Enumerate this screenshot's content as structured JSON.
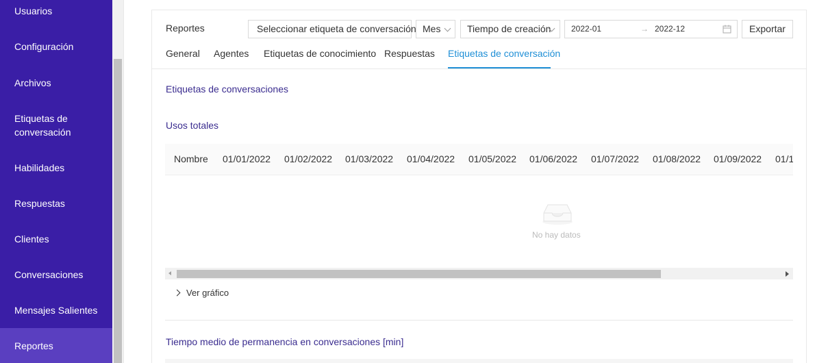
{
  "sidebar": {
    "items": [
      {
        "label": "Usuarios"
      },
      {
        "label": "Configuración"
      },
      {
        "label": "Archivos"
      },
      {
        "label": "Etiquetas de\nconversación"
      },
      {
        "label": "Habilidades"
      },
      {
        "label": "Respuestas"
      },
      {
        "label": "Clientes"
      },
      {
        "label": "Conversaciones"
      },
      {
        "label": "Mensajes Salientes"
      },
      {
        "label": "Reportes"
      }
    ],
    "active": "Reportes"
  },
  "toolbar": {
    "title": "Reportes",
    "tag_select": "Seleccionar etiqueta de conversación",
    "period_select": "Mes",
    "time_type_select": "Tiempo de creación",
    "date_start": "2022-01",
    "date_end": "2022-12",
    "date_arrow": "→",
    "export_label": "Exportar"
  },
  "tabs": [
    {
      "label": "General"
    },
    {
      "label": "Agentes"
    },
    {
      "label": "Etiquetas de conocimiento"
    },
    {
      "label": "Respuestas"
    },
    {
      "label": "Etiquetas de conversación"
    }
  ],
  "active_tab": "Etiquetas de conversación",
  "main": {
    "section_title": "Etiquetas de conversaciones",
    "usage_title": "Usos totales",
    "table": {
      "columns": [
        "Nombre",
        "01/01/2022",
        "01/02/2022",
        "01/03/2022",
        "01/04/2022",
        "01/05/2022",
        "01/06/2022",
        "01/07/2022",
        "01/08/2022",
        "01/09/2022",
        "01/1"
      ],
      "rows": []
    },
    "empty_text": "No hay datos",
    "view_chart": "Ver gráfico",
    "avg_time_title": "Tiempo medio de permanencia en conversaciones [min]"
  },
  "colors": {
    "sidebar_bg": "#3a1ea6",
    "accent": "#1f8fd6",
    "section_title": "#3a2c8f"
  }
}
